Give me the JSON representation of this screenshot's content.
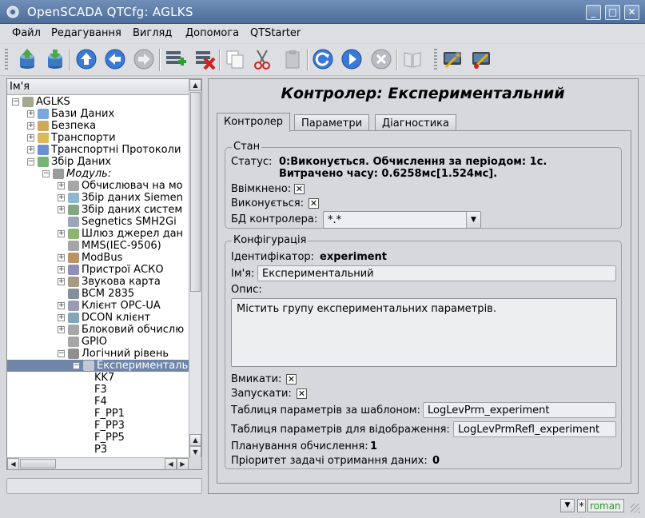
{
  "window": {
    "title": "OpenSCADA QTCfg: AGLKS",
    "minimize": "_",
    "maximize": "□",
    "close": "✕"
  },
  "menu": [
    "Файл",
    "Редагування",
    "Вигляд",
    "Допомога",
    "QTStarter"
  ],
  "toolbar": {
    "icons": [
      "db-load-icon",
      "db-save-icon",
      "up-icon",
      "back-icon",
      "forward-icon",
      "add-item-icon",
      "delete-item-icon",
      "copy-icon",
      "cut-icon",
      "paste-icon",
      "refresh-icon",
      "start-icon",
      "stop-icon",
      "manual-icon",
      "config-tool-icon",
      "config-tool2-icon"
    ]
  },
  "tree": {
    "header": "Ім'я",
    "items": [
      {
        "label": "AGLKS",
        "level": 0,
        "exp": "-"
      },
      {
        "label": "Бази Даних",
        "level": 1,
        "exp": "+"
      },
      {
        "label": "Безпека",
        "level": 1,
        "exp": "+"
      },
      {
        "label": "Транспорти",
        "level": 1,
        "exp": "+"
      },
      {
        "label": "Транспортні Протоколи",
        "level": 1,
        "exp": "+"
      },
      {
        "label": "Збір Даних",
        "level": 1,
        "exp": "-"
      },
      {
        "label": "Модуль:",
        "level": 2,
        "exp": "-",
        "italic": true
      },
      {
        "label": "Обчислювач на мо",
        "level": 3,
        "exp": "+"
      },
      {
        "label": "Збір даних Siemen",
        "level": 3,
        "exp": "+"
      },
      {
        "label": "Збір даних систем",
        "level": 3,
        "exp": "+"
      },
      {
        "label": "Segnetics SMH2Gi",
        "level": 3,
        "exp": ""
      },
      {
        "label": "Шлюз джерел дан",
        "level": 3,
        "exp": "+"
      },
      {
        "label": "MMS(IEC-9506)",
        "level": 3,
        "exp": ""
      },
      {
        "label": "ModBus",
        "level": 3,
        "exp": "+"
      },
      {
        "label": "Пристрої АСКО",
        "level": 3,
        "exp": "+"
      },
      {
        "label": "Звукова карта",
        "level": 3,
        "exp": "+"
      },
      {
        "label": "BCM 2835",
        "level": 3,
        "exp": ""
      },
      {
        "label": "Клієнт OPC-UA",
        "level": 3,
        "exp": "+"
      },
      {
        "label": "DCON клієнт",
        "level": 3,
        "exp": "+"
      },
      {
        "label": "Блоковий обчислю",
        "level": 3,
        "exp": "+"
      },
      {
        "label": "GPIO",
        "level": 3,
        "exp": ""
      },
      {
        "label": "Логічний рівень",
        "level": 3,
        "exp": "-"
      },
      {
        "label": "Експериментальни",
        "level": 4,
        "exp": "-",
        "selected": true
      },
      {
        "label": "KK7",
        "level": 5,
        "exp": ""
      },
      {
        "label": "F3",
        "level": 5,
        "exp": ""
      },
      {
        "label": "F4",
        "level": 5,
        "exp": ""
      },
      {
        "label": "F_PP1",
        "level": 5,
        "exp": ""
      },
      {
        "label": "F_PP3",
        "level": 5,
        "exp": ""
      },
      {
        "label": "F_PP5",
        "level": 5,
        "exp": ""
      },
      {
        "label": "P3",
        "level": 5,
        "exp": ""
      }
    ]
  },
  "page": {
    "title": "Контролер: Експериментальний"
  },
  "tabs": [
    "Контролер",
    "Параметри",
    "Діагностика"
  ],
  "state": {
    "group_title": "Стан",
    "status_label": "Статус:",
    "status_line1": "0:Виконується. Обчислення за періодом: 1с.",
    "status_line2": "Витрачено часу: 0.6258мс[1.524мс].",
    "enabled_label": "Ввімкнено:",
    "running_label": "Виконується:",
    "db_label": "БД контролера:",
    "db_value": "*.*"
  },
  "config": {
    "group_title": "Конфігурація",
    "id_label": "Ідентифікатор:",
    "id_value": "experiment",
    "name_label": "Ім'я:",
    "name_value": "Експериментальний",
    "descr_label": "Опис:",
    "descr_value": "Містить групу експериментальних параметрів.",
    "enable_label": "Вмикати:",
    "start_label": "Запускати:",
    "prm_table_label": "Таблиця параметрів за шаблоном:",
    "prm_table_value": "LogLevPrm_experiment",
    "prm_refl_label": "Таблиця параметрів для відображення:",
    "prm_refl_value": "LogLevPrmRefl_experiment",
    "sched_label": "Планування обчислення:",
    "sched_value": "1",
    "prior_label": "Пріоритет задачі отримання даних:",
    "prior_value": "0"
  },
  "statusbar": {
    "user": "roman",
    "mark": "*",
    "arrow": "▼"
  }
}
